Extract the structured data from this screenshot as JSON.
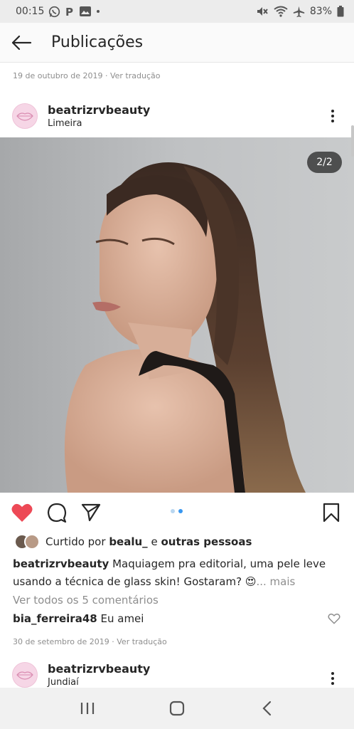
{
  "status_bar": {
    "time": "00:15",
    "battery": "83%",
    "icons": [
      "whatsapp-icon",
      "parking-icon",
      "image-icon",
      "dot-icon",
      "mute-icon",
      "wifi-icon",
      "airplane-icon",
      "battery-icon"
    ]
  },
  "header": {
    "title": "Publicações",
    "back_icon": "arrow-left-icon"
  },
  "previous_post": {
    "date": "19 de outubro de 2019",
    "translate": "Ver tradução"
  },
  "post": {
    "username": "beatrizrvbeauty",
    "location": "Limeira",
    "image_counter": "2/2",
    "liked_prefix": "Curtido por",
    "liked_user": "bealu_",
    "liked_and": "e",
    "liked_others": "outras pessoas",
    "caption_user": "beatrizrvbeauty",
    "caption_text": "Maquiagem pra editorial, uma pele leve usando a técnica de glass skin! Gostaram?",
    "caption_emoji": "😍",
    "caption_more": "... mais",
    "view_comments": "Ver todos os 5 comentários",
    "comment_user": "bia_ferreira48",
    "comment_text": "Eu amei",
    "date": "30 de setembro de 2019",
    "translate": "Ver tradução",
    "liked": true
  },
  "next_post": {
    "username": "beatrizrvbeauty",
    "location": "Jundiaí"
  },
  "colors": {
    "like_red": "#ed4956",
    "link_blue": "#3897f0",
    "muted_gray": "#8e8e8e"
  }
}
